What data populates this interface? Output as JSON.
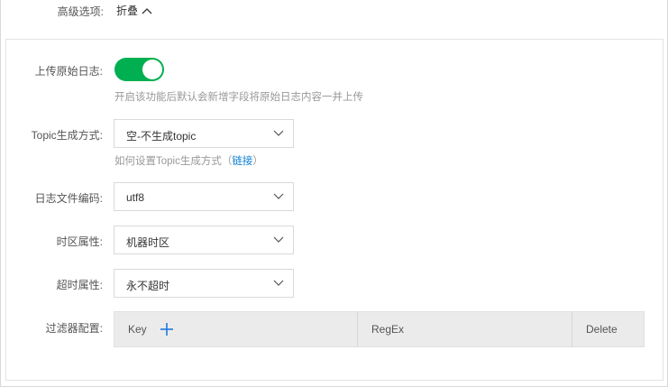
{
  "advanced": {
    "label": "高级选项:",
    "toggle_label": "折叠"
  },
  "upload_raw_log": {
    "label": "上传原始日志:",
    "enabled": true,
    "hint": "开启该功能后默认会新增字段将原始日志内容一并上传"
  },
  "topic_mode": {
    "label": "Topic生成方式:",
    "value": "空-不生成topic",
    "hint_prefix": "如何设置Topic生成方式（",
    "hint_link": "链接",
    "hint_suffix": "）"
  },
  "encoding": {
    "label": "日志文件编码:",
    "value": "utf8"
  },
  "timezone": {
    "label": "时区属性:",
    "value": "机器时区"
  },
  "timeout": {
    "label": "超时属性:",
    "value": "永不超时"
  },
  "filter": {
    "label": "过滤器配置:",
    "columns": {
      "key": "Key",
      "regex": "RegEx",
      "delete": "Delete"
    }
  },
  "colors": {
    "accent_green": "#00b050",
    "link_blue": "#0a7fd1"
  },
  "icons": {
    "collapse": "chevron-up-icon",
    "dropdown": "chevron-down-icon",
    "add": "plus-icon"
  }
}
